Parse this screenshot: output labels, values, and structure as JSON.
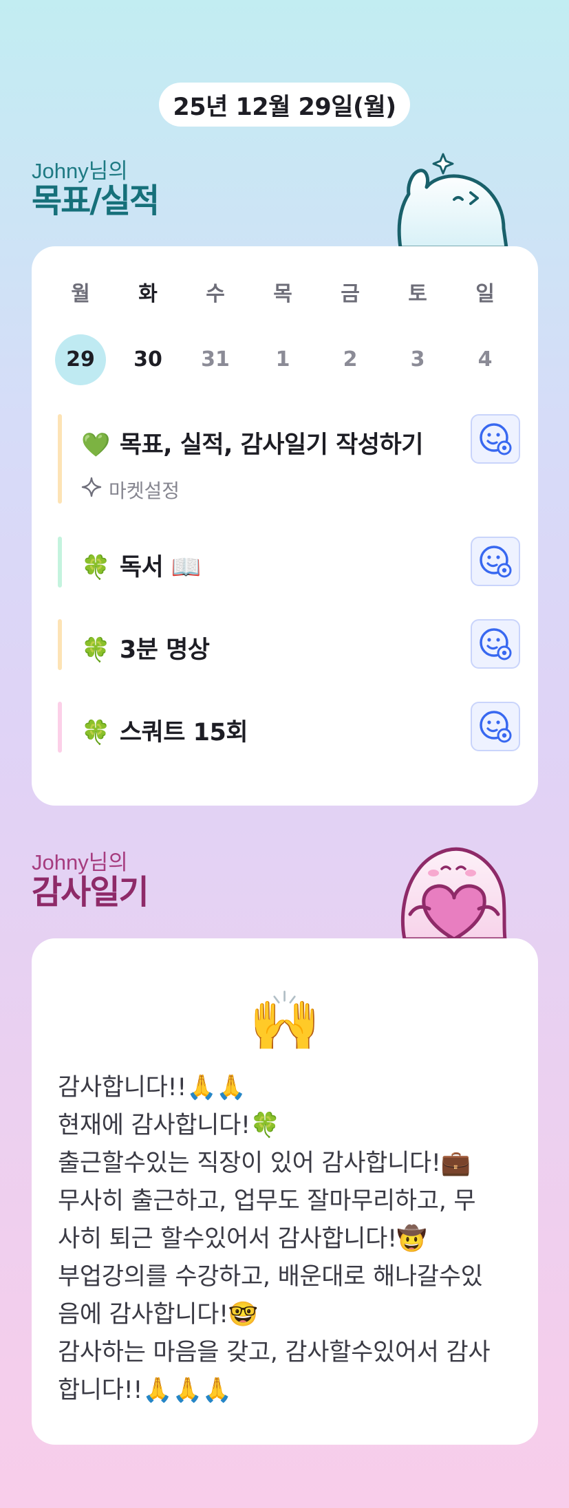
{
  "date_label": "25년 12월 29일(월)",
  "goals_section": {
    "owner": "Johny님의",
    "title": "목표/실적",
    "accent_color": "#16707a"
  },
  "week": [
    {
      "name": "월",
      "date": "29",
      "selected": true,
      "dark": true
    },
    {
      "name": "화",
      "date": "30",
      "selected": false,
      "dark": true,
      "today": true
    },
    {
      "name": "수",
      "date": "31",
      "selected": false,
      "dark": false
    },
    {
      "name": "목",
      "date": "1",
      "selected": false,
      "dark": false
    },
    {
      "name": "금",
      "date": "2",
      "selected": false,
      "dark": false
    },
    {
      "name": "토",
      "date": "3",
      "selected": false,
      "dark": false
    },
    {
      "name": "일",
      "date": "4",
      "selected": false,
      "dark": false
    }
  ],
  "goals": [
    {
      "emoji": "💚",
      "title": "목표, 실적, 감사일기 작성하기",
      "bar_color": "#fde3b5",
      "sub_icon": "sparkle-icon",
      "sub_label": "마켓설정"
    },
    {
      "emoji": "🍀",
      "title": "독서 📖",
      "bar_color": "#c4f3de"
    },
    {
      "emoji": "🍀",
      "title": "3분 명상",
      "bar_color": "#fde3b5"
    },
    {
      "emoji": "🍀",
      "title": "스쿼트 15회",
      "bar_color": "#fcd0e8"
    }
  ],
  "goal_action_icon": "smile-face-add-icon",
  "thanks_section": {
    "owner": "Johny님의",
    "title": "감사일기",
    "accent_color": "#8e2a68",
    "emoji": "🙌",
    "lines": [
      "감사합니다!!🙏🙏",
      "현재에 감사합니다!🍀",
      "출근할수있는 직장이 있어 감사합니다!💼",
      "무사히 출근하고, 업무도 잘마무리하고, 무",
      "사히 퇴근 할수있어서 감사합니다!🤠",
      "부업강의를 수강하고, 배운대로 해나갈수있",
      "음에 감사합니다!🤓",
      "감사하는 마음을 갖고, 감사할수있어서 감사",
      "합니다!!🙏🙏🙏"
    ]
  }
}
